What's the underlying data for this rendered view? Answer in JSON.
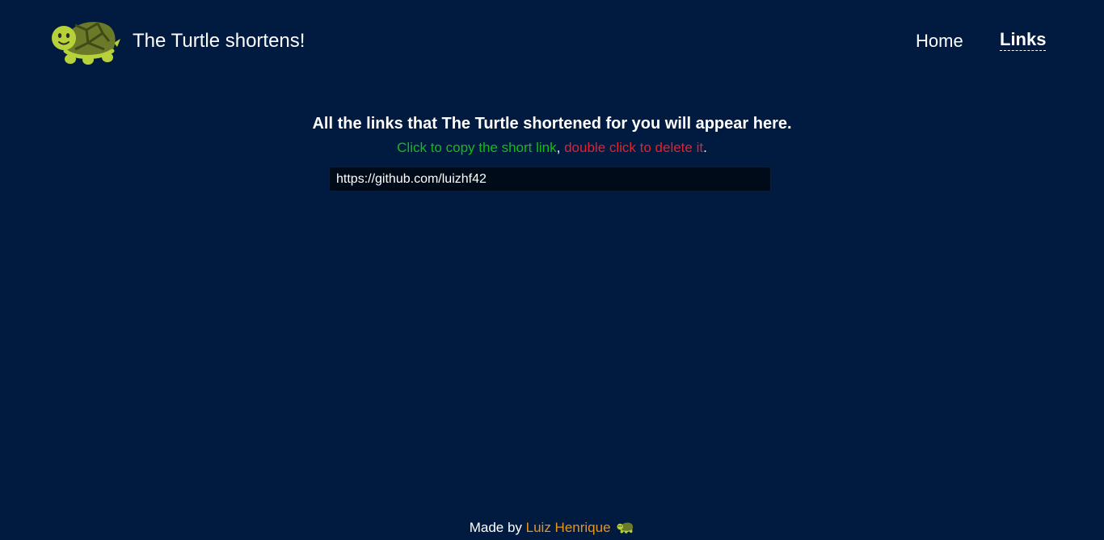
{
  "header": {
    "title": "The Turtle shortens!",
    "logo_icon": "turtle-icon"
  },
  "nav": {
    "items": [
      {
        "label": "Home",
        "active": false
      },
      {
        "label": "Links",
        "active": true
      }
    ]
  },
  "main": {
    "heading": "All the links that The Turtle shortened for you will appear here.",
    "copy_hint": "Click to copy the short link",
    "separator": ",",
    "delete_hint": "double click to delete it",
    "end_punct": ".",
    "links": [
      "https://github.com/luizhf42"
    ]
  },
  "footer": {
    "made_by": "Made by",
    "author": "Luiz Henrique",
    "turtle_icon": "turtle-icon"
  },
  "colors": {
    "background": "#001a40",
    "copy_hint": "#19b81e",
    "delete_hint": "#e0232f",
    "author_link": "#e8951c",
    "link_box": "#000b1a"
  }
}
